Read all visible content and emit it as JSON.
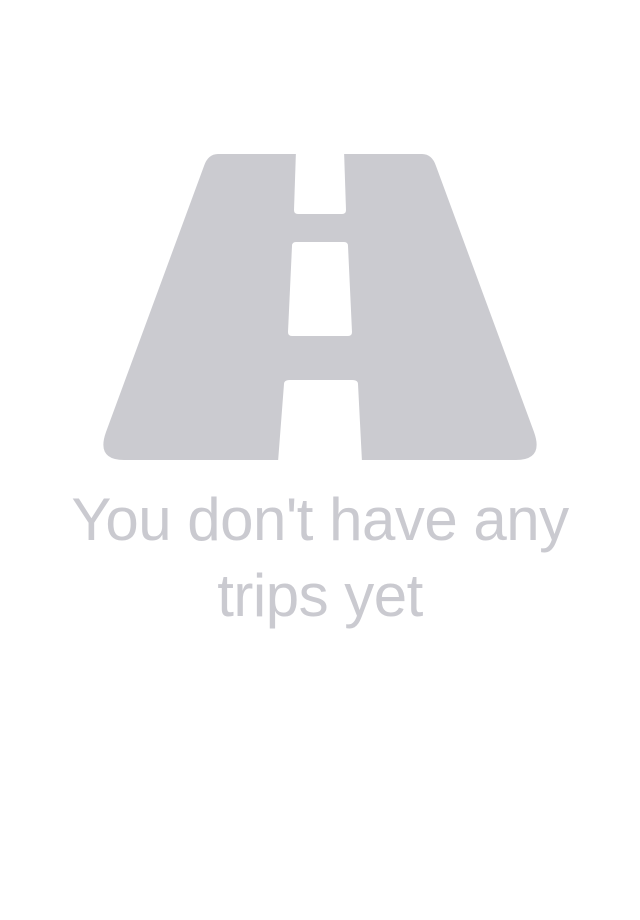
{
  "empty_state": {
    "icon": "road-icon",
    "icon_color": "#cbcbd0",
    "message": "You don't have any trips yet",
    "text_color": "#cacad0"
  },
  "background_color": "#ffffff"
}
